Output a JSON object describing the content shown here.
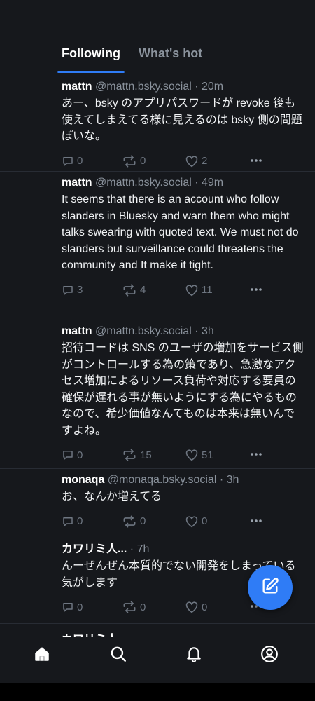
{
  "tabs": {
    "following": "Following",
    "whats_hot": "What's hot",
    "active": "following"
  },
  "accent_color": "#2f7cf6",
  "feed": {
    "posts": [
      {
        "author": "mattn",
        "handle": "@mattn.bsky.social",
        "time": "· 20m",
        "text": "あー、bsky のアプリパスワードが revoke 後も使えてしまえてる様に見えるのは bsky 側の問題ぽいな。",
        "replies": "0",
        "reposts": "0",
        "likes": "2"
      },
      {
        "author": "mattn",
        "handle": "@mattn.bsky.social",
        "time": "· 49m",
        "text": "It seems that there is an account who follow slanders in Bluesky and warn them who might talks swearing with quoted text. We must not do slanders but surveillance could threatens the community and It make it tight.",
        "replies": "3",
        "reposts": "4",
        "likes": "11"
      },
      {
        "author": "mattn",
        "handle": "@mattn.bsky.social",
        "time": "· 3h",
        "text": "招待コードは SNS のユーザの増加をサービス側がコントロールする為の策であり、急激なアクセス増加によるリソース負荷や対応する要員の確保が遅れる事が無いようにする為にやるものなので、希少価値なんてものは本来は無いんですよね。",
        "replies": "0",
        "reposts": "15",
        "likes": "51"
      },
      {
        "author": "monaqa",
        "handle": "@monaqa.bsky.social",
        "time": "· 3h",
        "text": "お、なんか増えてる",
        "replies": "0",
        "reposts": "0",
        "likes": "0"
      },
      {
        "author": "カワリミ人...",
        "handle": "",
        "time": "· 7h",
        "text": "んーぜんぜん本質的でない開発をしまっている気がします",
        "replies": "0",
        "reposts": "0",
        "likes": "0"
      }
    ],
    "peek_author": "カワリミ人..."
  },
  "icons": {
    "reply": "comment-icon",
    "repost": "repost-icon",
    "like": "heart-icon",
    "more": "ellipsis-icon",
    "compose": "compose-icon",
    "home": "home-icon",
    "search": "search-icon",
    "notifications": "bell-icon",
    "profile": "profile-icon"
  }
}
